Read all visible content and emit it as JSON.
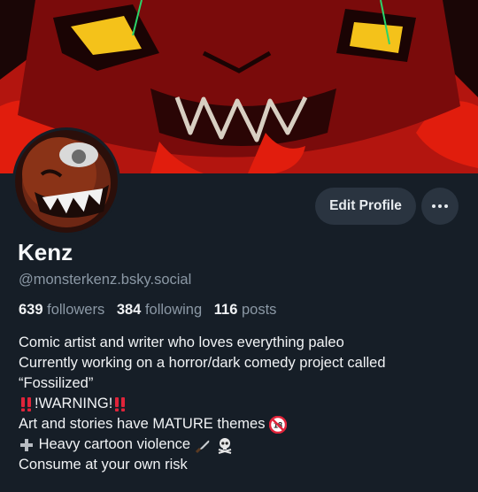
{
  "profile": {
    "display_name": "Kenz",
    "handle": "@monsterkenz.bsky.social",
    "followers_count": "639",
    "followers_label": "followers",
    "following_count": "384",
    "following_label": "following",
    "posts_count": "116",
    "posts_label": "posts"
  },
  "actions": {
    "edit_label": "Edit Profile",
    "more_icon": "ellipsis-icon"
  },
  "bio": {
    "line1": "Comic artist and writer who loves everything paleo",
    "line2": "Currently working on a horror/dark comedy project called",
    "line3": "“Fossilized”",
    "line4": "!WARNING!",
    "line5": "Art and stories have MATURE themes",
    "line6": "Heavy cartoon violence",
    "line7": "Consume at your own risk"
  },
  "colors": {
    "background": "#161e27",
    "button": "#2a3440",
    "muted_text": "#8b98a5",
    "emoji_red": "#e0243a"
  }
}
